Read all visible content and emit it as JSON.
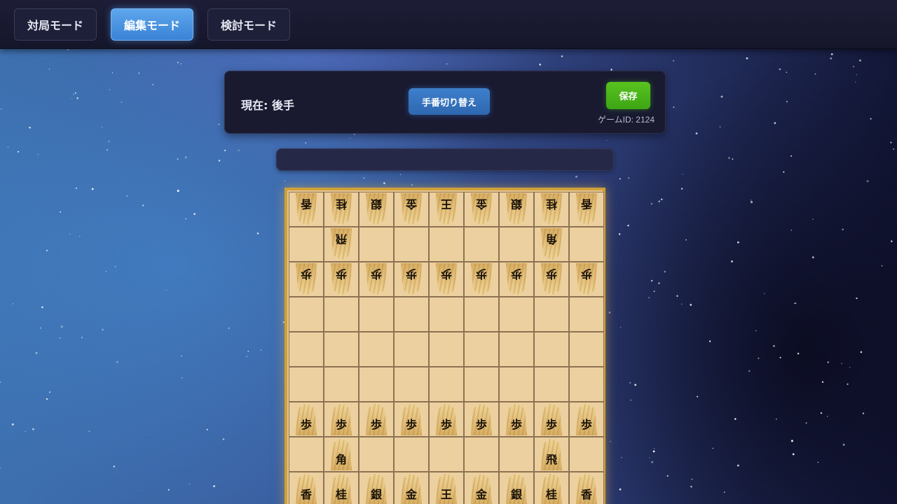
{
  "nav": {
    "tabs": [
      {
        "label": "対局モード",
        "active": false
      },
      {
        "label": "編集モード",
        "active": true
      },
      {
        "label": "検討モード",
        "active": false
      }
    ]
  },
  "panel": {
    "turn_text": "現在: 後手",
    "switch_turn_label": "手番切り替え",
    "save_label": "保存",
    "game_id_text": "ゲームID: 2124"
  },
  "message_bar": {
    "text": ""
  },
  "colors": {
    "active_tab": "#3a83d6",
    "save_button": "#3ea514",
    "board": "#ecd09f",
    "board_frame": "#cfa03a"
  },
  "board": {
    "rows": [
      [
        "香v",
        "桂v",
        "銀v",
        "金v",
        "王v",
        "金v",
        "銀v",
        "桂v",
        "香v"
      ],
      [
        "",
        "飛v",
        "",
        "",
        "",
        "",
        "",
        "角v",
        ""
      ],
      [
        "歩v",
        "歩v",
        "歩v",
        "歩v",
        "歩v",
        "歩v",
        "歩v",
        "歩v",
        "歩v"
      ],
      [
        "",
        "",
        "",
        "",
        "",
        "",
        "",
        "",
        ""
      ],
      [
        "",
        "",
        "",
        "",
        "",
        "",
        "",
        "",
        ""
      ],
      [
        "",
        "",
        "",
        "",
        "",
        "",
        "",
        "",
        ""
      ],
      [
        "歩",
        "歩",
        "歩",
        "歩",
        "歩",
        "歩",
        "歩",
        "歩",
        "歩"
      ],
      [
        "",
        "角",
        "",
        "",
        "",
        "",
        "",
        "飛",
        ""
      ],
      [
        "香",
        "桂",
        "銀",
        "金",
        "王",
        "金",
        "銀",
        "桂",
        "香"
      ]
    ]
  }
}
